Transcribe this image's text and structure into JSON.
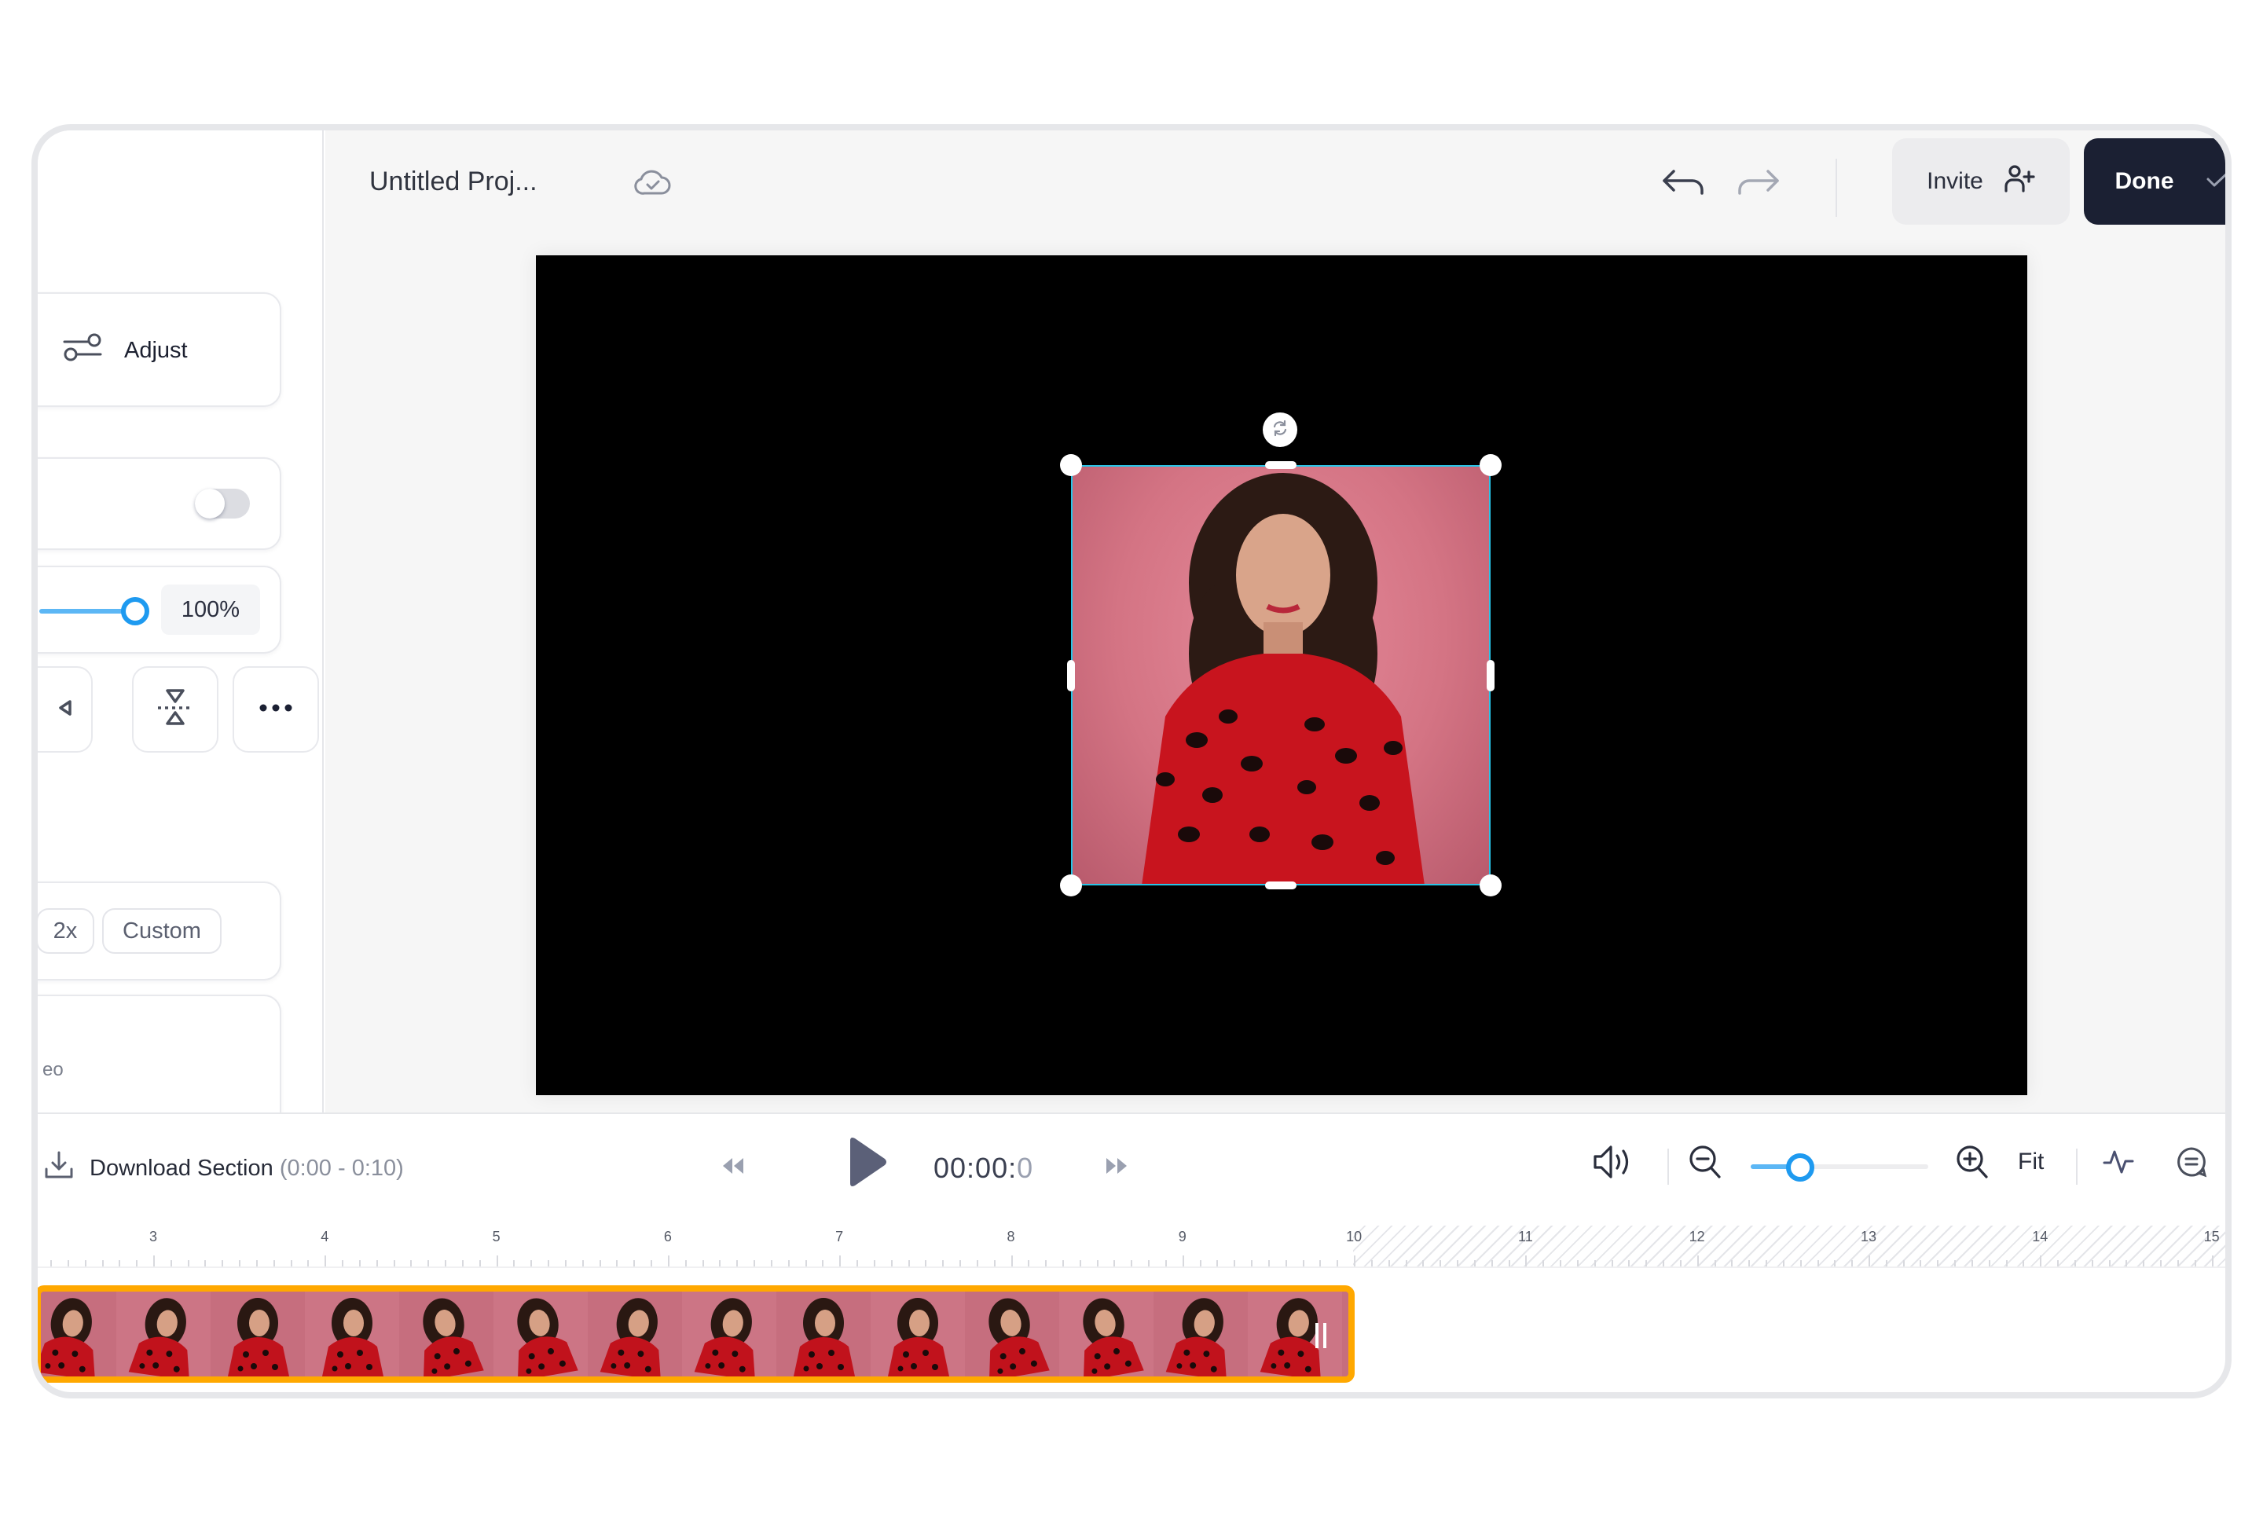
{
  "header": {
    "project_title": "Untitled Proj...",
    "invite_label": "Invite",
    "done_label": "Done"
  },
  "sidebar": {
    "adjust_label": "Adjust",
    "toggle_on": false,
    "opacity_value": "100%",
    "opacity_fraction": 1.0,
    "speed_options": [
      "x",
      "2x",
      "Custom"
    ],
    "video_panel_text": "eo"
  },
  "toolbar": {
    "download_label": "Download Section",
    "download_range": "(0:00 - 0:10)",
    "time_main": "00:00:",
    "time_frac": "0",
    "fit_label": "Fit",
    "zoom_fraction": 0.28
  },
  "timeline": {
    "ruler_labels": [
      "3",
      "4",
      "5",
      "6",
      "7",
      "8",
      "9",
      "10",
      "11",
      "12",
      "13",
      "14",
      "15"
    ],
    "clip_end_seconds": 10,
    "clip_thumbnail_count": 14
  },
  "colors": {
    "accent_blue": "#1e9af0",
    "clip_border": "#ffa800",
    "selection_border": "#29c4e6",
    "done_bg": "#1b2033"
  }
}
